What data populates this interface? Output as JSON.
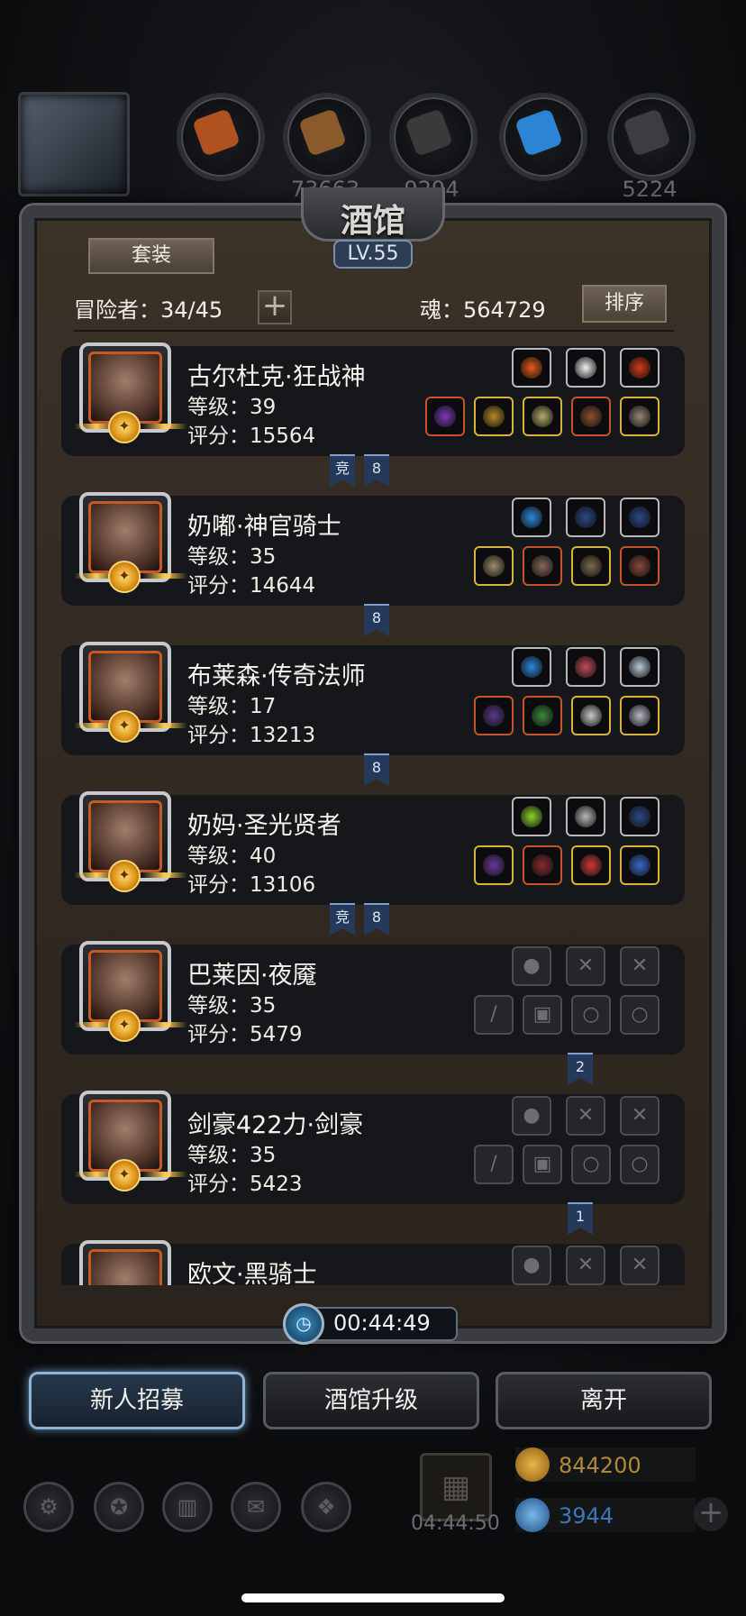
{
  "hud": {
    "resources": [
      {
        "icon": "meat-icon",
        "value": "",
        "color": "#b0521f"
      },
      {
        "icon": "wood-icon",
        "value": "73663",
        "color": "#8b5a2b"
      },
      {
        "icon": "stone-icon",
        "value": "9294",
        "color": "#3a3a3a"
      },
      {
        "icon": "crystal-icon",
        "value": "",
        "color": "#2b84d4"
      },
      {
        "icon": "iron-icon",
        "value": "5224",
        "color": "#3c3d40"
      }
    ]
  },
  "panel": {
    "title": "酒馆",
    "level": "LV.55",
    "set_button": "套装",
    "adventurers_label": "冒险者：34/45",
    "soul_label": "魂：564729",
    "sort_button": "排序"
  },
  "heroes": [
    {
      "name": "古尔杜克·狂战神",
      "level": "等级：39",
      "score": "评分：15564",
      "tags": [
        "竞",
        "8"
      ],
      "top_slots": [
        {
          "kind": "fire",
          "color": "#e55a1a"
        },
        {
          "kind": "wing",
          "color": "#f0f0f0"
        },
        {
          "kind": "gem",
          "color": "#d33a1a"
        }
      ],
      "bottom_slots": [
        {
          "kind": "axe",
          "color": "#7a3ab5",
          "frame": "red"
        },
        {
          "kind": "armor",
          "color": "#b58a2a",
          "frame": "gold"
        },
        {
          "kind": "helm",
          "color": "#b5aa6a",
          "frame": "gold"
        },
        {
          "kind": "helm2",
          "color": "#8a5030",
          "frame": "red"
        },
        {
          "kind": "ring",
          "color": "#9a8470",
          "frame": "gold"
        }
      ]
    },
    {
      "name": "奶嘟·神官骑士",
      "level": "等级：35",
      "score": "评分：14644",
      "tags": [
        "8"
      ],
      "top_slots": [
        {
          "kind": "orb",
          "color": "#2e86e0"
        },
        {
          "kind": "bow",
          "color": "#2a4a8a"
        },
        {
          "kind": "bow",
          "color": "#2a4a8a"
        }
      ],
      "bottom_slots": [
        {
          "kind": "mace",
          "color": "#9a8a6a",
          "frame": "gold"
        },
        {
          "kind": "armor",
          "color": "#8a6a5a",
          "frame": "red"
        },
        {
          "kind": "mask",
          "color": "#7a6a4a",
          "frame": "gold"
        },
        {
          "kind": "book",
          "color": "#8a4a3a",
          "frame": "red"
        }
      ]
    },
    {
      "name": "布莱森·传奇法师",
      "level": "等级：17",
      "score": "评分：13213",
      "tags": [
        "8"
      ],
      "top_slots": [
        {
          "kind": "orb",
          "color": "#2e86e0"
        },
        {
          "kind": "fang",
          "color": "#c44a5a"
        },
        {
          "kind": "star",
          "color": "#b8c8d8"
        }
      ],
      "bottom_slots": [
        {
          "kind": "staff",
          "color": "#5a3a8a",
          "frame": "red"
        },
        {
          "kind": "armor",
          "color": "#3a8a3a",
          "frame": "red"
        },
        {
          "kind": "necklace",
          "color": "#c8c8c8",
          "frame": "gold"
        },
        {
          "kind": "sword",
          "color": "#b8b8c8",
          "frame": "gold"
        }
      ]
    },
    {
      "name": "奶妈·圣光贤者",
      "level": "等级：40",
      "score": "评分：13106",
      "tags": [
        "竞",
        "8"
      ],
      "top_slots": [
        {
          "kind": "flame",
          "color": "#8ad22a"
        },
        {
          "kind": "badge",
          "color": "#b8b8b8"
        },
        {
          "kind": "bow",
          "color": "#2a4a8a"
        }
      ],
      "bottom_slots": [
        {
          "kind": "staff",
          "color": "#6a3a9a",
          "frame": "gold"
        },
        {
          "kind": "armor",
          "color": "#8a2a2a",
          "frame": "red"
        },
        {
          "kind": "heart",
          "color": "#c83a3a",
          "frame": "gold"
        },
        {
          "kind": "necklace",
          "color": "#3a6ac8",
          "frame": "gold"
        }
      ]
    },
    {
      "name": "巴莱因·夜魇",
      "level": "等级：35",
      "score": "评分：5479",
      "tags": [
        "2"
      ],
      "top_slots": [
        {
          "kind": "empty",
          "glyph": "●"
        },
        {
          "kind": "empty",
          "glyph": "✕"
        },
        {
          "kind": "empty",
          "glyph": "✕"
        }
      ],
      "bottom_slots": [
        {
          "kind": "empty",
          "glyph": "/"
        },
        {
          "kind": "empty",
          "glyph": "▣"
        },
        {
          "kind": "empty",
          "glyph": "○"
        },
        {
          "kind": "empty",
          "glyph": "○"
        }
      ]
    },
    {
      "name": "剑豪422力·剑豪",
      "level": "等级：35",
      "score": "评分：5423",
      "tags": [
        "1"
      ],
      "top_slots": [
        {
          "kind": "empty",
          "glyph": "●"
        },
        {
          "kind": "empty",
          "glyph": "✕"
        },
        {
          "kind": "empty",
          "glyph": "✕"
        }
      ],
      "bottom_slots": [
        {
          "kind": "empty",
          "glyph": "/"
        },
        {
          "kind": "empty",
          "glyph": "▣"
        },
        {
          "kind": "empty",
          "glyph": "○"
        },
        {
          "kind": "empty",
          "glyph": "○"
        }
      ]
    },
    {
      "name": "欧文·黑骑士",
      "level": "",
      "score": "",
      "tags": [],
      "top_slots": [
        {
          "kind": "empty",
          "glyph": "●"
        },
        {
          "kind": "empty",
          "glyph": "✕"
        },
        {
          "kind": "empty",
          "glyph": "✕"
        }
      ],
      "bottom_slots": []
    }
  ],
  "timer": {
    "value": "00:44:49"
  },
  "buttons": {
    "recruit": "新人招募",
    "upgrade": "酒馆升级",
    "leave": "离开"
  },
  "footer": {
    "gift_timer": "04:44:50",
    "gold": "844200",
    "gems": "3944"
  }
}
